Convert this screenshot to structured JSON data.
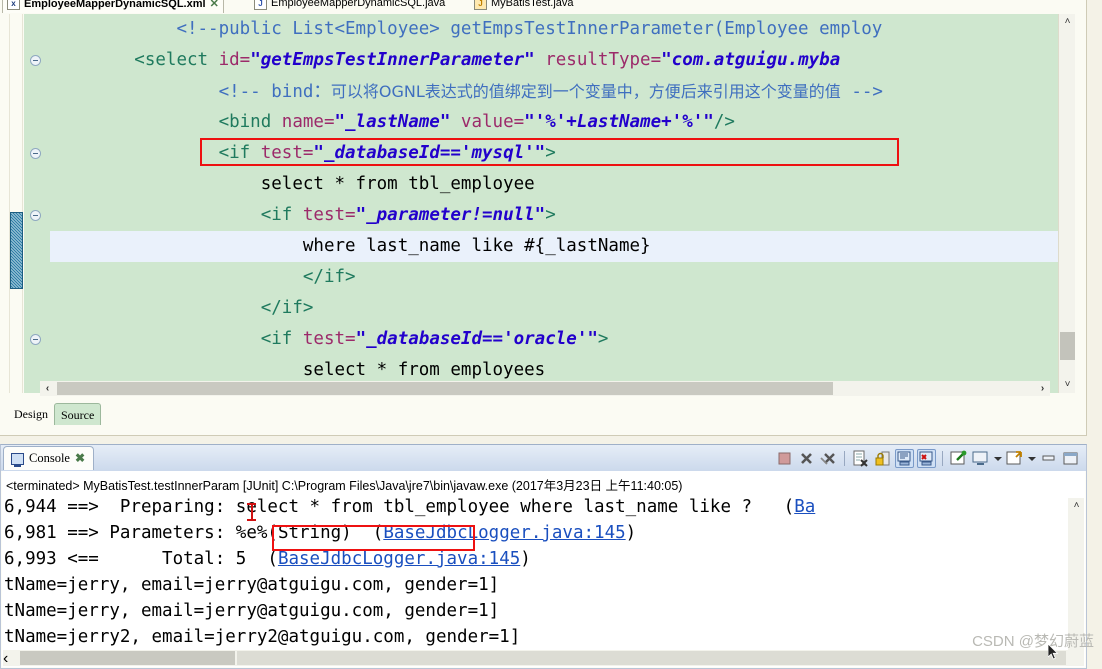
{
  "editor": {
    "tabs": [
      {
        "label": "EmployeeMapperDynamicSQL.xml",
        "icon": "xml-file-icon",
        "active": true,
        "close": "✕"
      },
      {
        "label": "EmployeeMapperDynamicSQL.java",
        "icon": "java-file-icon",
        "active": false
      },
      {
        "label": "MyBatisTest.java",
        "icon": "java-warning-file-icon",
        "active": false
      }
    ],
    "code_lines": [
      {
        "indent": 1,
        "segments": [
          {
            "t": "<!--public List<Employee> getEmpsTestInnerParameter(Employee employ",
            "c": "cmt"
          }
        ]
      },
      {
        "indent": 0,
        "segments": [
          {
            "t": "<select ",
            "c": "tag"
          },
          {
            "t": "id=",
            "c": "attr"
          },
          {
            "t": "\"getEmpsTestInnerParameter\"",
            "c": "str"
          },
          {
            "t": " resultType=",
            "c": "attr"
          },
          {
            "t": "\"com.atguigu.myba",
            "c": "str"
          }
        ]
      },
      {
        "indent": 2,
        "segments": [
          {
            "t": "<!-- bind：",
            "c": "cmt"
          },
          {
            "t": "可以将OGNL表达式的值绑定到一个变量中，方便后来引用这个变量的值",
            "c": "cn"
          },
          {
            "t": " -->",
            "c": "cmt"
          }
        ]
      },
      {
        "indent": 2,
        "segments": [
          {
            "t": "<bind ",
            "c": "tag"
          },
          {
            "t": "name=",
            "c": "attr"
          },
          {
            "t": "\"_lastName\"",
            "c": "str"
          },
          {
            "t": " value=",
            "c": "attr"
          },
          {
            "t": "\"'%'+LastName+'%'\"",
            "c": "str"
          },
          {
            "t": "/>",
            "c": "tag"
          }
        ]
      },
      {
        "indent": 2,
        "segments": [
          {
            "t": "<if ",
            "c": "tag"
          },
          {
            "t": "test=",
            "c": "attr"
          },
          {
            "t": "\"_databaseId=='mysql'\"",
            "c": "str"
          },
          {
            "t": ">",
            "c": "tag"
          }
        ]
      },
      {
        "indent": 3,
        "segments": [
          {
            "t": "select * from tbl_employee",
            "c": "plain"
          }
        ]
      },
      {
        "indent": 3,
        "segments": [
          {
            "t": "<if ",
            "c": "tag"
          },
          {
            "t": "test=",
            "c": "attr"
          },
          {
            "t": "\"_parameter!=null\"",
            "c": "str"
          },
          {
            "t": ">",
            "c": "tag"
          }
        ]
      },
      {
        "indent": 4,
        "highlight": true,
        "segments": [
          {
            "t": "where last_name like #{_lastName}",
            "c": "plain"
          }
        ]
      },
      {
        "indent": 4,
        "segments": [
          {
            "t": "</if>",
            "c": "tag"
          }
        ]
      },
      {
        "indent": 3,
        "segments": [
          {
            "t": "</if>",
            "c": "tag"
          }
        ]
      },
      {
        "indent": 3,
        "segments": [
          {
            "t": "<if ",
            "c": "tag"
          },
          {
            "t": "test=",
            "c": "attr"
          },
          {
            "t": "\"_databaseId=='oracle'\"",
            "c": "str"
          },
          {
            "t": ">",
            "c": "tag"
          }
        ]
      },
      {
        "indent": 4,
        "segments": [
          {
            "t": "select * from employees",
            "c": "plain"
          }
        ]
      }
    ],
    "bottom_tabs": [
      {
        "label": "Design",
        "selected": false
      },
      {
        "label": "Source",
        "selected": true
      }
    ],
    "scroll_up_icon": "˄",
    "scroll_down_icon": "˅",
    "scroll_left_icon": "‹",
    "scroll_right_icon": "›"
  },
  "console": {
    "tab_label": "Console",
    "tab_close_icon": "✖",
    "terminated_line": "<terminated> MyBatisTest.testInnerParam [JUnit] C:\\Program Files\\Java\\jre7\\bin\\javaw.exe (2017年3月23日 上午11:40:05)",
    "tools": [
      {
        "name": "terminate-button",
        "icon": "stop-square-icon"
      },
      {
        "name": "remove-launch-button",
        "icon": "x-gray-icon"
      },
      {
        "name": "remove-all-terminated-button",
        "icon": "xx-gray-icon"
      },
      {
        "name": "clear-console-button",
        "icon": "clear-console-icon"
      },
      {
        "name": "lock-scroll-button",
        "icon": "lock-icon"
      },
      {
        "name": "scroll-lock-button",
        "icon": "scroll-lock-icon",
        "selected": true
      },
      {
        "name": "show-console-on-output-button",
        "icon": "console-error-icon",
        "selected": true
      },
      {
        "name": "pin-console-button",
        "icon": "pin-icon"
      },
      {
        "name": "display-selected-console-button",
        "icon": "display-console-icon"
      },
      {
        "name": "open-console-button",
        "icon": "open-console-icon"
      },
      {
        "name": "minimize-button",
        "icon": "minimize-icon"
      },
      {
        "name": "maximize-button",
        "icon": "maximize-icon"
      }
    ],
    "output_lines": [
      {
        "segments": [
          {
            "t": "6,944 ==>  Preparing: select * from tbl_employee where last_name like ?   (",
            "c": "plain"
          },
          {
            "t": "Ba",
            "c": "link"
          }
        ]
      },
      {
        "segments": [
          {
            "t": "6,981 ==> Parameters: ",
            "c": "plain"
          },
          {
            "t": "%e%(String)",
            "c": "plain"
          },
          {
            "t": "  (",
            "c": "plain"
          },
          {
            "t": "BaseJdbcLogger.java:145",
            "c": "link"
          },
          {
            "t": ")",
            "c": "plain"
          }
        ]
      },
      {
        "segments": [
          {
            "t": "6,993 <==      Total: 5  (",
            "c": "plain"
          },
          {
            "t": "BaseJdbcLogger.java:145",
            "c": "link"
          },
          {
            "t": ")",
            "c": "plain"
          }
        ]
      },
      {
        "segments": [
          {
            "t": "tName=jerry, email=jerry@atguigu.com, gender=1]",
            "c": "plain"
          }
        ]
      },
      {
        "segments": [
          {
            "t": "tName=jerry, email=jerry@atguigu.com, gender=1]",
            "c": "plain"
          }
        ]
      },
      {
        "segments": [
          {
            "t": "tName=jerry2, email=jerry2@atguigu.com, gender=1]",
            "c": "plain"
          }
        ]
      }
    ]
  },
  "annotations": {
    "code_box_color": "#ee1111",
    "console_box_color": "#ee1111",
    "caret_color": "#d01010"
  },
  "watermark": {
    "text": "CSDN @梦幻蔚蓝"
  }
}
